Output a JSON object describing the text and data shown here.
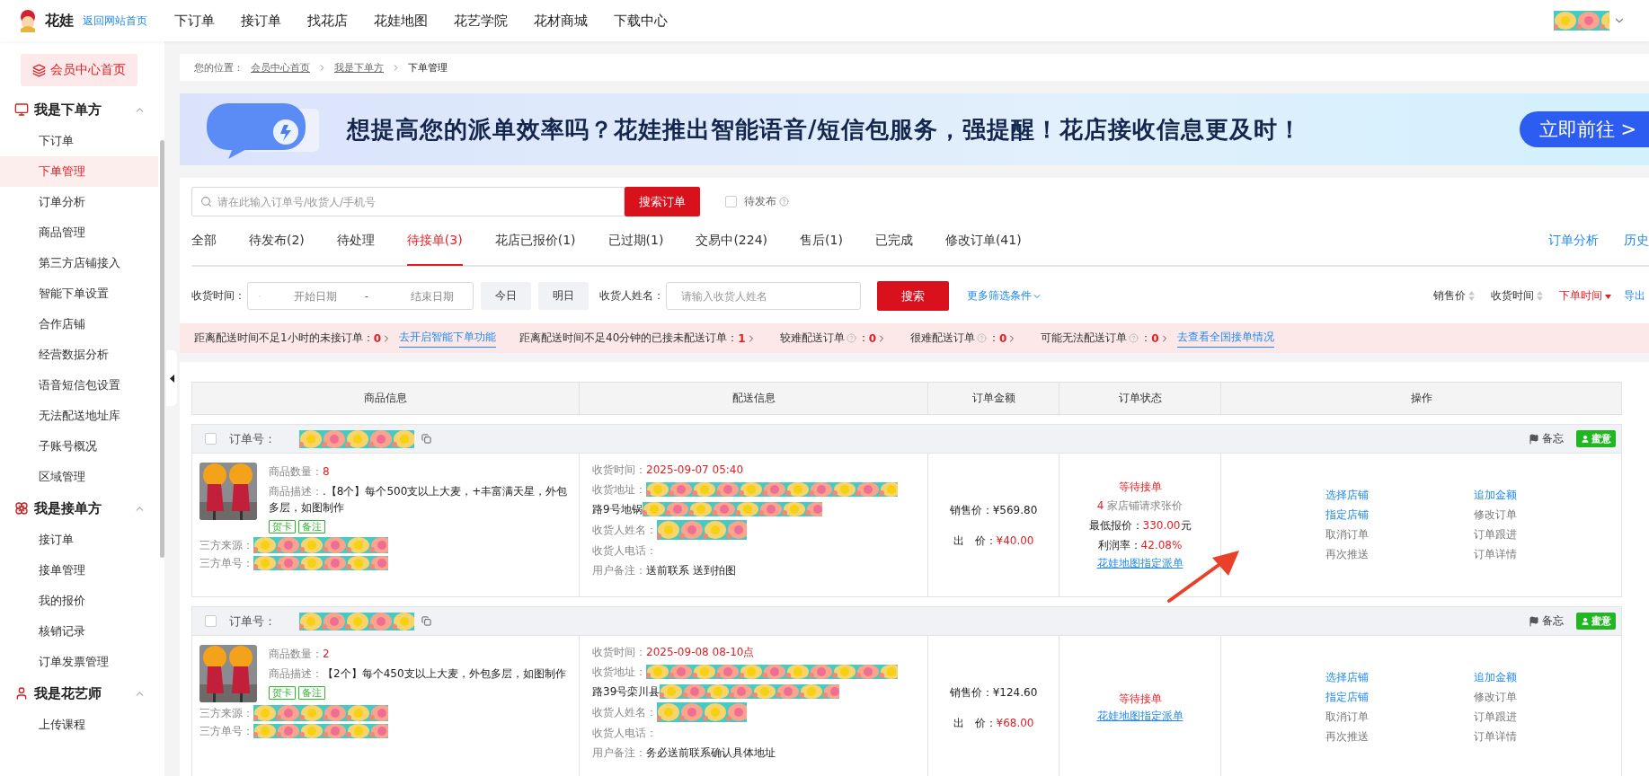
{
  "header": {
    "logo_text": "花娃",
    "back_link": "返回网站首页",
    "nav": [
      "下订单",
      "接订单",
      "找花店",
      "花娃地图",
      "花艺学院",
      "花材商城",
      "下载中心"
    ]
  },
  "sidebar": {
    "home_button": "会员中心首页",
    "groups": [
      {
        "title": "我是下单方",
        "expanded": true,
        "items": [
          {
            "label": "下订单",
            "selected": false
          },
          {
            "label": "下单管理",
            "selected": true
          },
          {
            "label": "订单分析",
            "selected": false
          },
          {
            "label": "商品管理",
            "selected": false
          },
          {
            "label": "第三方店铺接入",
            "selected": false
          },
          {
            "label": "智能下单设置",
            "selected": false
          },
          {
            "label": "合作店铺",
            "selected": false
          },
          {
            "label": "经营数据分析",
            "selected": false
          },
          {
            "label": "语音短信包设置",
            "selected": false
          },
          {
            "label": "无法配送地址库",
            "selected": false
          },
          {
            "label": "子账号概况",
            "selected": false
          },
          {
            "label": "区域管理",
            "selected": false
          }
        ]
      },
      {
        "title": "我是接单方",
        "expanded": true,
        "items": [
          {
            "label": "接订单",
            "selected": false
          },
          {
            "label": "接单管理",
            "selected": false
          },
          {
            "label": "我的报价",
            "selected": false
          },
          {
            "label": "核销记录",
            "selected": false
          },
          {
            "label": "订单发票管理",
            "selected": false
          }
        ]
      },
      {
        "title": "我是花艺师",
        "expanded": true,
        "items": [
          {
            "label": "上传课程",
            "selected": false
          }
        ]
      }
    ]
  },
  "breadcrumb": {
    "prefix": "您的位置：",
    "items": [
      "会员中心首页",
      "我是下单方",
      "下单管理"
    ]
  },
  "banner": {
    "text": "想提高您的派单效率吗？花娃推出智能语音/短信包服务，强提醒！花店接收信息更及时！",
    "button": "立即前往 >"
  },
  "search": {
    "placeholder": "请在此输入订单号/收货人/手机号",
    "button": "搜索订单",
    "pending": {
      "label": "待发布",
      "checked": false
    }
  },
  "tabs": [
    {
      "label": "全部",
      "selected": false
    },
    {
      "label": "待发布(2)",
      "selected": false
    },
    {
      "label": "待处理",
      "selected": false
    },
    {
      "label": "待接单(3)",
      "selected": true
    },
    {
      "label": "花店已报价(1)",
      "selected": false
    },
    {
      "label": "已过期(1)",
      "selected": false
    },
    {
      "label": "交易中(224)",
      "selected": false
    },
    {
      "label": "售后(1)",
      "selected": false
    },
    {
      "label": "已完成",
      "selected": false
    },
    {
      "label": "修改订单(41)",
      "selected": false
    }
  ],
  "tab_links": [
    "订单分析",
    "历史"
  ],
  "filters": {
    "time_label": "收货时间：",
    "start_placeholder": "开始日期",
    "separator": "-",
    "end_placeholder": "结束日期",
    "quick": [
      "今日",
      "明日"
    ],
    "name_label": "收货人姓名：",
    "name_placeholder": "请输入收货人姓名",
    "search_button": "搜索",
    "more": "更多筛选条件"
  },
  "sorts": [
    {
      "label": "销售价",
      "selected": false
    },
    {
      "label": "收货时间",
      "selected": false
    },
    {
      "label": "下单时间",
      "selected": true
    }
  ],
  "export": "导出",
  "alerts": [
    {
      "label": "距离配送时间不足1小时的未接订单：",
      "help": false,
      "count": "0",
      "link": "去开启智能下单功能"
    },
    {
      "label": "距离配送时间不足40分钟的已接未配送订单：",
      "help": false,
      "count": "1"
    },
    {
      "label": "较难配送订单",
      "help": true,
      "colon": "：",
      "count": "0"
    },
    {
      "label": "很难配送订单",
      "help": true,
      "colon": "：",
      "count": "0"
    },
    {
      "label": "可能无法配送订单",
      "help": true,
      "colon": "：",
      "count": "0",
      "link": "去查看全国接单情况"
    }
  ],
  "table": {
    "columns": [
      "商品信息",
      "配送信息",
      "订单金额",
      "订单状态",
      "操作"
    ],
    "orders": [
      {
        "selected": false,
        "order_no_label": "订单号：",
        "memo": "备忘",
        "contact": "蜜意",
        "quantity_label": "商品数量：",
        "quantity": "8",
        "desc_label": "商品描述：",
        "description": ".【8个】每个500支以上大麦，+丰富满天星，外包多层，如图制作",
        "tags": [
          "贺卡",
          "备注"
        ],
        "source_label": "三方来源：",
        "third_no_label": "三方单号：",
        "time_label": "收货时间：",
        "time": "2025-09-07 05:40",
        "address_label": "收货地址：",
        "address": "路9号地锅",
        "name_label": "收货人姓名：",
        "phone_label": "收货人电话：",
        "remark_label": "用户备注：",
        "remark": "送前联系 送到拍图",
        "sale_label": "销售价：",
        "sale": "¥569.80",
        "bid_label": "出　价：",
        "bid": "¥40.00",
        "status": "等待接单",
        "raise_count": "4",
        "raise_text": "家店铺请求张价",
        "min_label": "最低报价：",
        "min": "330.00",
        "min_unit": "元",
        "profit_label": "利润率：",
        "profit": "42.08%",
        "map_link": "花娃地图指定派单",
        "actions": [
          {
            "label": "选择店铺",
            "kind": "link"
          },
          {
            "label": "追加金额",
            "kind": "link"
          },
          {
            "label": "指定店铺",
            "kind": "link"
          },
          {
            "label": "修改订单",
            "kind": "plain"
          },
          {
            "label": "取消订单",
            "kind": "plain"
          },
          {
            "label": "订单跟进",
            "kind": "plain"
          },
          {
            "label": "再次推送",
            "kind": "plain"
          },
          {
            "label": "订单详情",
            "kind": "plain"
          }
        ]
      },
      {
        "selected": false,
        "order_no_label": "订单号：",
        "memo": "备忘",
        "contact": "蜜意",
        "quantity_label": "商品数量：",
        "quantity": "2",
        "desc_label": "商品描述：",
        "description": "【2个】每个450支以上大麦，外包多层，如图制作",
        "tags": [
          "贺卡",
          "备注"
        ],
        "source_label": "三方来源：",
        "third_no_label": "三方单号：",
        "time_label": "收货时间：",
        "time": "2025-09-08 08-10点",
        "address_label": "收货地址：",
        "address": "路39号栾川县",
        "name_label": "收货人姓名：",
        "phone_label": "收货人电话：",
        "remark_label": "用户备注：",
        "remark": "务必送前联系确认具体地址",
        "sale_label": "销售价：",
        "sale": "¥124.60",
        "bid_label": "出　价：",
        "bid": "¥68.00",
        "status": "等待接单",
        "map_link": "花娃地图指定派单",
        "actions": [
          {
            "label": "选择店铺",
            "kind": "link"
          },
          {
            "label": "追加金额",
            "kind": "link"
          },
          {
            "label": "指定店铺",
            "kind": "link"
          },
          {
            "label": "修改订单",
            "kind": "plain"
          },
          {
            "label": "取消订单",
            "kind": "plain"
          },
          {
            "label": "订单跟进",
            "kind": "plain"
          },
          {
            "label": "再次推送",
            "kind": "plain"
          },
          {
            "label": "订单详情",
            "kind": "plain"
          }
        ]
      }
    ]
  }
}
